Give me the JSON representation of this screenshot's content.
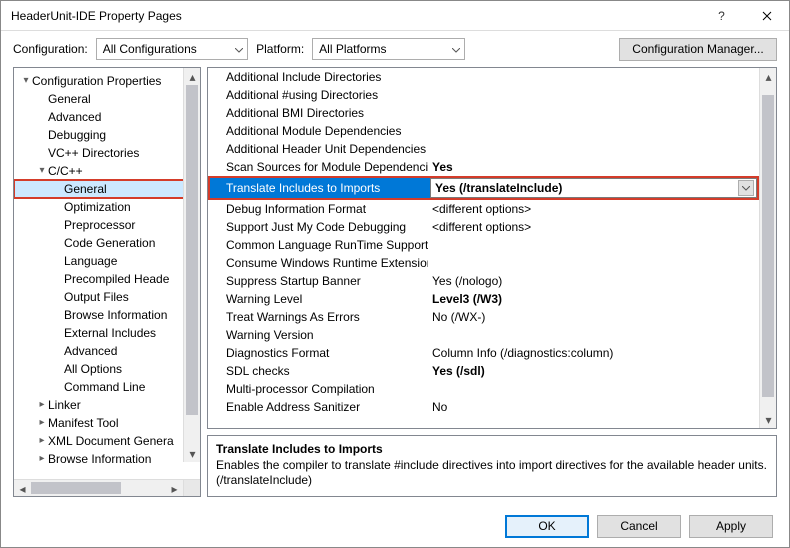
{
  "title": "HeaderUnit-IDE Property Pages",
  "configRow": {
    "configLabel": "Configuration:",
    "configValue": "All Configurations",
    "platformLabel": "Platform:",
    "platformValue": "All Platforms",
    "managerBtn": "Configuration Manager..."
  },
  "tree": {
    "root": "Configuration Properties",
    "items_l1a": [
      "General",
      "Advanced",
      "Debugging",
      "VC++ Directories"
    ],
    "cpp": "C/C++",
    "items_l2": [
      "General",
      "Optimization",
      "Preprocessor",
      "Code Generation",
      "Language",
      "Precompiled Heade",
      "Output Files",
      "Browse Information",
      "External Includes",
      "Advanced",
      "All Options",
      "Command Line"
    ],
    "items_l1b": [
      "Linker",
      "Manifest Tool",
      "XML Document Genera",
      "Browse Information"
    ]
  },
  "props": [
    {
      "name": "Additional Include Directories",
      "value": ""
    },
    {
      "name": "Additional #using Directories",
      "value": ""
    },
    {
      "name": "Additional BMI Directories",
      "value": ""
    },
    {
      "name": "Additional Module Dependencies",
      "value": ""
    },
    {
      "name": "Additional Header Unit Dependencies",
      "value": ""
    },
    {
      "name": "Scan Sources for Module Dependencies",
      "value": "Yes",
      "bold": true
    },
    {
      "name": "Translate Includes to Imports",
      "value": "Yes (/translateInclude)",
      "highlight": true
    },
    {
      "name": "Debug Information Format",
      "value": "<different options>"
    },
    {
      "name": "Support Just My Code Debugging",
      "value": "<different options>"
    },
    {
      "name": "Common Language RunTime Support",
      "value": ""
    },
    {
      "name": "Consume Windows Runtime Extension",
      "value": ""
    },
    {
      "name": "Suppress Startup Banner",
      "value": "Yes (/nologo)"
    },
    {
      "name": "Warning Level",
      "value": "Level3 (/W3)",
      "bold": true
    },
    {
      "name": "Treat Warnings As Errors",
      "value": "No (/WX-)"
    },
    {
      "name": "Warning Version",
      "value": ""
    },
    {
      "name": "Diagnostics Format",
      "value": "Column Info (/diagnostics:column)"
    },
    {
      "name": "SDL checks",
      "value": "Yes (/sdl)",
      "bold": true
    },
    {
      "name": "Multi-processor Compilation",
      "value": ""
    },
    {
      "name": "Enable Address Sanitizer",
      "value": "No"
    }
  ],
  "desc": {
    "title": "Translate Includes to Imports",
    "text": "Enables the compiler to translate #include directives into import directives for the available header units. (/translateInclude)"
  },
  "footer": {
    "ok": "OK",
    "cancel": "Cancel",
    "apply": "Apply"
  }
}
